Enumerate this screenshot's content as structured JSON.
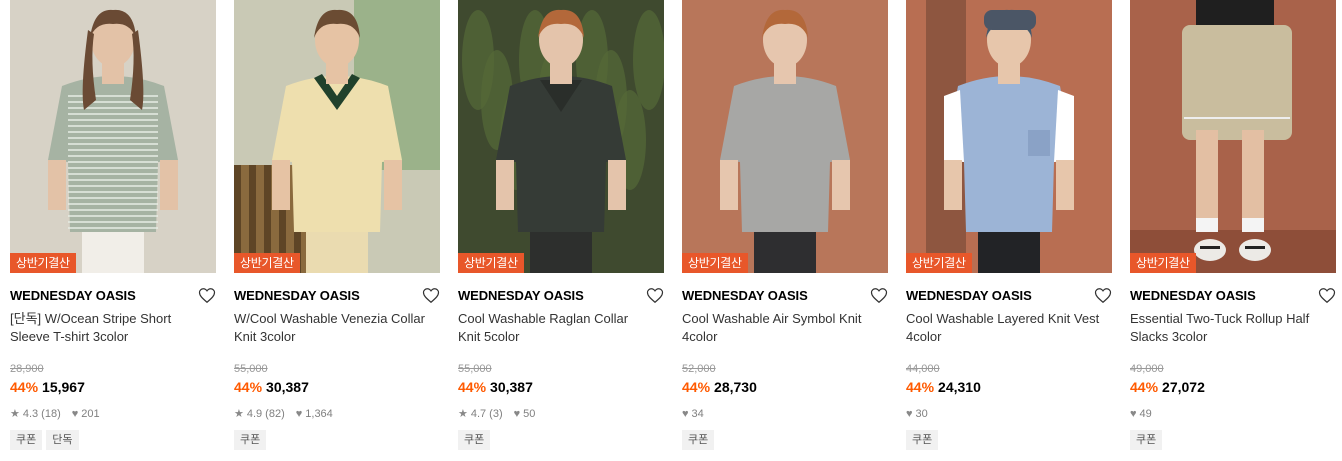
{
  "products": [
    {
      "promo": "상반기결산",
      "brand": "WEDNESDAY OASIS",
      "title": "[단독] W/Ocean Stripe Short Sleeve T-shirt 3color",
      "original_price": "28,900",
      "discount": "44%",
      "price": "15,967",
      "rating": "4.3",
      "reviews": "(18)",
      "likes": "201",
      "tags": [
        "쿠폰",
        "단독"
      ],
      "image_desc": "woman in striped green tee",
      "colors": {
        "bg": "#d7d2c6",
        "top": "#a6b3a3",
        "bottom": "#f1eee8",
        "skin": "#e3c2a7"
      }
    },
    {
      "promo": "상반기결산",
      "brand": "WEDNESDAY OASIS",
      "title": "W/Cool Washable Venezia Collar Knit 3color",
      "original_price": "55,000",
      "discount": "44%",
      "price": "30,387",
      "rating": "4.9",
      "reviews": "(82)",
      "likes": "1,364",
      "tags": [
        "쿠폰"
      ],
      "image_desc": "woman in yellow knit sitting",
      "colors": {
        "bg": "#c9c9b5",
        "top": "#eedfae",
        "bottom": "#eadbb0",
        "skin": "#e6c3a4"
      }
    },
    {
      "promo": "상반기결산",
      "brand": "WEDNESDAY OASIS",
      "title": "Cool Washable Raglan Collar Knit 5color",
      "original_price": "55,000",
      "discount": "44%",
      "price": "30,387",
      "rating": "4.7",
      "reviews": "(3)",
      "likes": "50",
      "tags": [
        "쿠폰"
      ],
      "image_desc": "man in dark green polo knit",
      "colors": {
        "bg": "#3f4a2f",
        "top": "#353b36",
        "bottom": "#2d2f2d",
        "skin": "#e4c4ab"
      }
    },
    {
      "promo": "상반기결산",
      "brand": "WEDNESDAY OASIS",
      "title": "Cool Washable Air Symbol Knit 4color",
      "original_price": "52,000",
      "discount": "44%",
      "price": "28,730",
      "rating": "",
      "reviews": "",
      "likes": "34",
      "tags": [
        "쿠폰"
      ],
      "image_desc": "man in grey henley knit",
      "colors": {
        "bg": "#b8765a",
        "top": "#a7a7a5",
        "bottom": "#2e2e30",
        "skin": "#e6c6ae"
      }
    },
    {
      "promo": "상반기결산",
      "brand": "WEDNESDAY OASIS",
      "title": "Cool Washable Layered Knit Vest 4color",
      "original_price": "44,000",
      "discount": "44%",
      "price": "24,310",
      "rating": "",
      "reviews": "",
      "likes": "30",
      "tags": [
        "쿠폰"
      ],
      "image_desc": "man in light blue knit vest with cap",
      "colors": {
        "bg": "#b86e52",
        "top": "#9cb4d6",
        "bottom": "#222326",
        "skin": "#e7c6ab"
      }
    },
    {
      "promo": "상반기결산",
      "brand": "WEDNESDAY OASIS",
      "title": "Essential Two-Tuck Rollup Half Slacks 3color",
      "original_price": "49,000",
      "discount": "44%",
      "price": "27,072",
      "rating": "",
      "reviews": "",
      "likes": "49",
      "tags": [
        "쿠폰"
      ],
      "image_desc": "beige half slacks with sneakers",
      "colors": {
        "bg": "#a9624a",
        "top": "#1f1f1f",
        "bottom": "#c9bd9e",
        "skin": "#e3bfa3"
      }
    }
  ],
  "theme": {
    "discount_color": "#ff5a00",
    "promo_badge_color": "#e8572a"
  }
}
